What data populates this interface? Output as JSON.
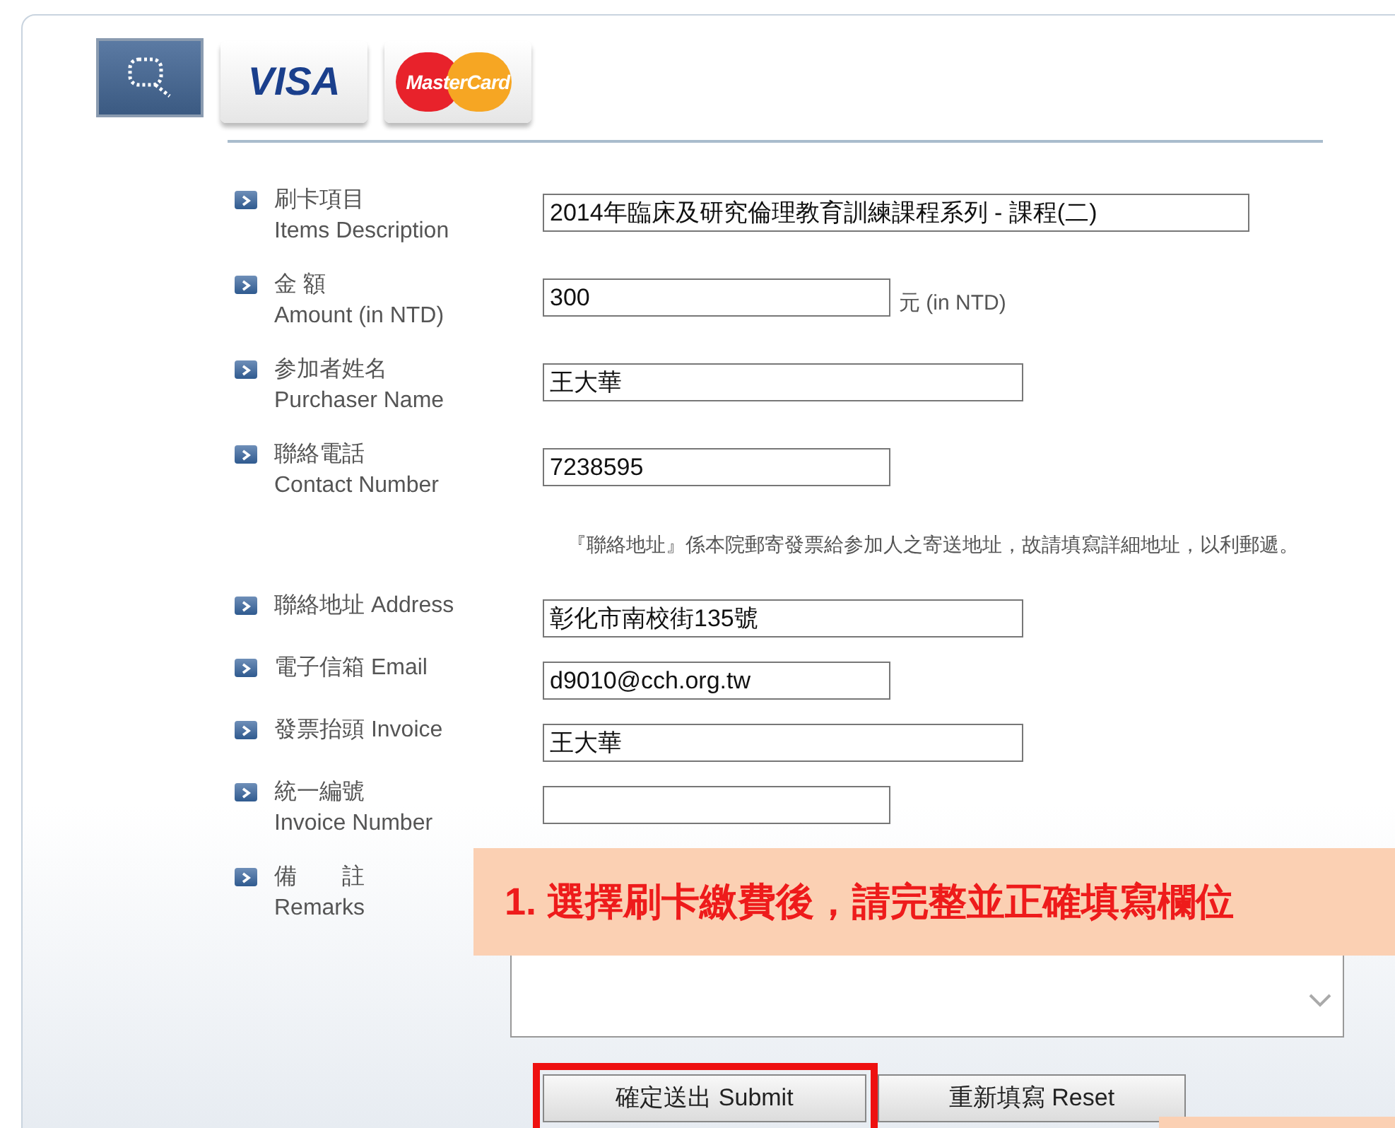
{
  "card_brands": [
    {
      "kind": "search"
    },
    {
      "kind": "visa",
      "label": "VISA"
    },
    {
      "kind": "mastercard",
      "label": "MasterCard"
    }
  ],
  "fields": [
    {
      "kind": "input",
      "label": "刷卡項目",
      "label_en": "Items Description",
      "value": "2014年臨床及研究倫理教育訓練課程系列 - 課程(二)"
    },
    {
      "kind": "input",
      "label": "金 額",
      "label_en": "Amount (in NTD)",
      "value": "300",
      "suffix": "元 (in NTD)"
    },
    {
      "kind": "input",
      "label": "参加者姓名",
      "label_en": "Purchaser Name",
      "value": "王大華"
    },
    {
      "kind": "input",
      "label": "聯絡電話",
      "label_en": "Contact Number",
      "value": "7238595"
    },
    {
      "kind": "note",
      "text": "『聯絡地址』係本院郵寄發票給参加人之寄送地址，故請填寫詳細地址，以利郵遞。"
    },
    {
      "kind": "input",
      "label": "聯絡地址 Address",
      "value": "彰化市南校街135號"
    },
    {
      "kind": "input",
      "label": "電子信箱 Email",
      "value": "d9010@cch.org.tw"
    },
    {
      "kind": "input",
      "label": "發票抬頭 Invoice",
      "value": "王大華"
    },
    {
      "kind": "input",
      "label": "統一編號",
      "label_en": "Invoice Number"
    },
    {
      "kind": "textarea",
      "label": "備　　註",
      "label_en": "Remarks"
    }
  ],
  "buttons": [
    {
      "label": "確定送出 Submit",
      "highlighted": true
    },
    {
      "label": "重新填寫 Reset",
      "highlighted": false
    }
  ],
  "callout": {
    "text": "1.  選擇刷卡繳費後，請完整並正確填寫欄位"
  }
}
